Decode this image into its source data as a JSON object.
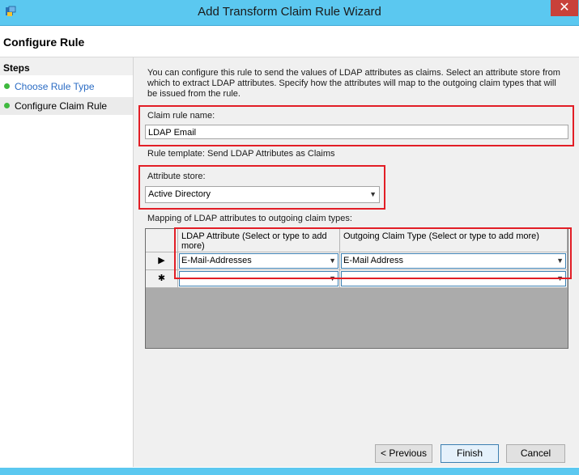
{
  "window": {
    "title": "Add Transform Claim Rule Wizard",
    "close_glyph": "✕"
  },
  "header": {
    "title": "Configure Rule"
  },
  "steps": {
    "title": "Steps",
    "items": [
      {
        "label": "Choose Rule Type"
      },
      {
        "label": "Configure Claim Rule"
      }
    ]
  },
  "content": {
    "description": "You can configure this rule to send the values of LDAP attributes as claims. Select an attribute store from which to extract LDAP attributes. Specify how the attributes will map to the outgoing claim types that will be issued from the rule.",
    "claim_rule_name_label": "Claim rule name:",
    "claim_rule_name_value": "LDAP Email",
    "rule_template_text": "Rule template: Send LDAP Attributes as Claims",
    "attribute_store_label": "Attribute store:",
    "attribute_store_value": "Active Directory",
    "mapping_label": "Mapping of LDAP attributes to outgoing claim types:"
  },
  "grid": {
    "columns": [
      "LDAP Attribute (Select or type to add more)",
      "Outgoing Claim Type (Select or type to add more)"
    ],
    "rows": [
      {
        "marker": "▶",
        "ldap": "E-Mail-Addresses",
        "claim": "E-Mail Address"
      },
      {
        "marker": "✱",
        "ldap": "",
        "claim": ""
      }
    ]
  },
  "buttons": {
    "previous": "< Previous",
    "finish": "Finish",
    "cancel": "Cancel"
  },
  "colors": {
    "titlebar": "#5bc8f0",
    "highlight": "#e21e26",
    "step_dot": "#3fb93f",
    "link": "#2b6cc4"
  }
}
